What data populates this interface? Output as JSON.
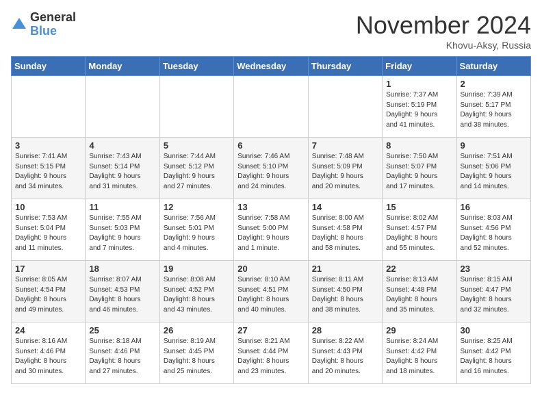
{
  "logo": {
    "general": "General",
    "blue": "Blue"
  },
  "header": {
    "month": "November 2024",
    "location": "Khovu-Aksy, Russia"
  },
  "days_of_week": [
    "Sunday",
    "Monday",
    "Tuesday",
    "Wednesday",
    "Thursday",
    "Friday",
    "Saturday"
  ],
  "weeks": [
    [
      {
        "day": "",
        "info": ""
      },
      {
        "day": "",
        "info": ""
      },
      {
        "day": "",
        "info": ""
      },
      {
        "day": "",
        "info": ""
      },
      {
        "day": "",
        "info": ""
      },
      {
        "day": "1",
        "info": "Sunrise: 7:37 AM\nSunset: 5:19 PM\nDaylight: 9 hours\nand 41 minutes."
      },
      {
        "day": "2",
        "info": "Sunrise: 7:39 AM\nSunset: 5:17 PM\nDaylight: 9 hours\nand 38 minutes."
      }
    ],
    [
      {
        "day": "3",
        "info": "Sunrise: 7:41 AM\nSunset: 5:15 PM\nDaylight: 9 hours\nand 34 minutes."
      },
      {
        "day": "4",
        "info": "Sunrise: 7:43 AM\nSunset: 5:14 PM\nDaylight: 9 hours\nand 31 minutes."
      },
      {
        "day": "5",
        "info": "Sunrise: 7:44 AM\nSunset: 5:12 PM\nDaylight: 9 hours\nand 27 minutes."
      },
      {
        "day": "6",
        "info": "Sunrise: 7:46 AM\nSunset: 5:10 PM\nDaylight: 9 hours\nand 24 minutes."
      },
      {
        "day": "7",
        "info": "Sunrise: 7:48 AM\nSunset: 5:09 PM\nDaylight: 9 hours\nand 20 minutes."
      },
      {
        "day": "8",
        "info": "Sunrise: 7:50 AM\nSunset: 5:07 PM\nDaylight: 9 hours\nand 17 minutes."
      },
      {
        "day": "9",
        "info": "Sunrise: 7:51 AM\nSunset: 5:06 PM\nDaylight: 9 hours\nand 14 minutes."
      }
    ],
    [
      {
        "day": "10",
        "info": "Sunrise: 7:53 AM\nSunset: 5:04 PM\nDaylight: 9 hours\nand 11 minutes."
      },
      {
        "day": "11",
        "info": "Sunrise: 7:55 AM\nSunset: 5:03 PM\nDaylight: 9 hours\nand 7 minutes."
      },
      {
        "day": "12",
        "info": "Sunrise: 7:56 AM\nSunset: 5:01 PM\nDaylight: 9 hours\nand 4 minutes."
      },
      {
        "day": "13",
        "info": "Sunrise: 7:58 AM\nSunset: 5:00 PM\nDaylight: 9 hours\nand 1 minute."
      },
      {
        "day": "14",
        "info": "Sunrise: 8:00 AM\nSunset: 4:58 PM\nDaylight: 8 hours\nand 58 minutes."
      },
      {
        "day": "15",
        "info": "Sunrise: 8:02 AM\nSunset: 4:57 PM\nDaylight: 8 hours\nand 55 minutes."
      },
      {
        "day": "16",
        "info": "Sunrise: 8:03 AM\nSunset: 4:56 PM\nDaylight: 8 hours\nand 52 minutes."
      }
    ],
    [
      {
        "day": "17",
        "info": "Sunrise: 8:05 AM\nSunset: 4:54 PM\nDaylight: 8 hours\nand 49 minutes."
      },
      {
        "day": "18",
        "info": "Sunrise: 8:07 AM\nSunset: 4:53 PM\nDaylight: 8 hours\nand 46 minutes."
      },
      {
        "day": "19",
        "info": "Sunrise: 8:08 AM\nSunset: 4:52 PM\nDaylight: 8 hours\nand 43 minutes."
      },
      {
        "day": "20",
        "info": "Sunrise: 8:10 AM\nSunset: 4:51 PM\nDaylight: 8 hours\nand 40 minutes."
      },
      {
        "day": "21",
        "info": "Sunrise: 8:11 AM\nSunset: 4:50 PM\nDaylight: 8 hours\nand 38 minutes."
      },
      {
        "day": "22",
        "info": "Sunrise: 8:13 AM\nSunset: 4:48 PM\nDaylight: 8 hours\nand 35 minutes."
      },
      {
        "day": "23",
        "info": "Sunrise: 8:15 AM\nSunset: 4:47 PM\nDaylight: 8 hours\nand 32 minutes."
      }
    ],
    [
      {
        "day": "24",
        "info": "Sunrise: 8:16 AM\nSunset: 4:46 PM\nDaylight: 8 hours\nand 30 minutes."
      },
      {
        "day": "25",
        "info": "Sunrise: 8:18 AM\nSunset: 4:46 PM\nDaylight: 8 hours\nand 27 minutes."
      },
      {
        "day": "26",
        "info": "Sunrise: 8:19 AM\nSunset: 4:45 PM\nDaylight: 8 hours\nand 25 minutes."
      },
      {
        "day": "27",
        "info": "Sunrise: 8:21 AM\nSunset: 4:44 PM\nDaylight: 8 hours\nand 23 minutes."
      },
      {
        "day": "28",
        "info": "Sunrise: 8:22 AM\nSunset: 4:43 PM\nDaylight: 8 hours\nand 20 minutes."
      },
      {
        "day": "29",
        "info": "Sunrise: 8:24 AM\nSunset: 4:42 PM\nDaylight: 8 hours\nand 18 minutes."
      },
      {
        "day": "30",
        "info": "Sunrise: 8:25 AM\nSunset: 4:42 PM\nDaylight: 8 hours\nand 16 minutes."
      }
    ]
  ]
}
